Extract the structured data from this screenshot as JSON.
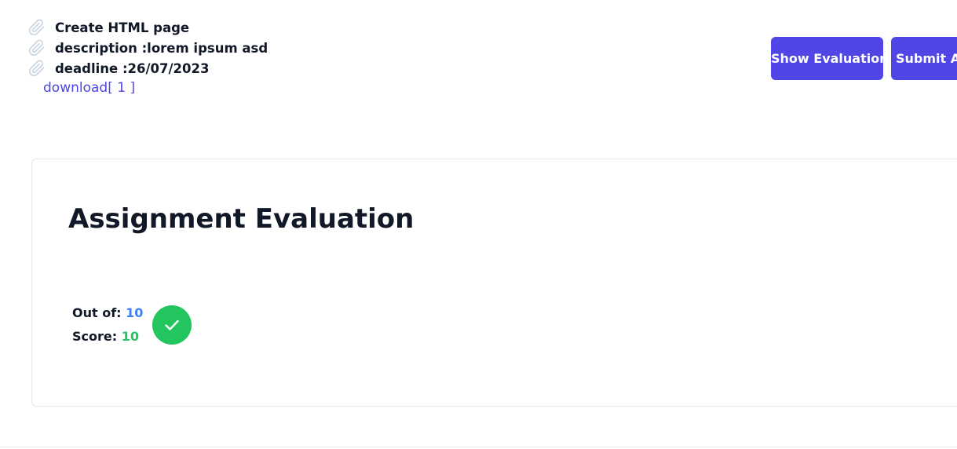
{
  "assignment": {
    "title": "Create HTML page",
    "description": "description :lorem ipsum asd",
    "deadline": "deadline :26/07/2023",
    "download_label": "download[ 1 ]",
    "item_icon": "paperclip-icon"
  },
  "actions": {
    "show_evaluation_label": "Show Evaluation",
    "submit_label": "Submit As"
  },
  "evaluation": {
    "heading": "Assignment Evaluation",
    "out_of_label": "Out of:",
    "out_of_value": "10",
    "score_label": "Score:",
    "score_value": "10",
    "status_icon": "check-icon"
  },
  "colors": {
    "primary": "#4f46e5",
    "success": "#22c55e",
    "info": "#3b82f6"
  }
}
